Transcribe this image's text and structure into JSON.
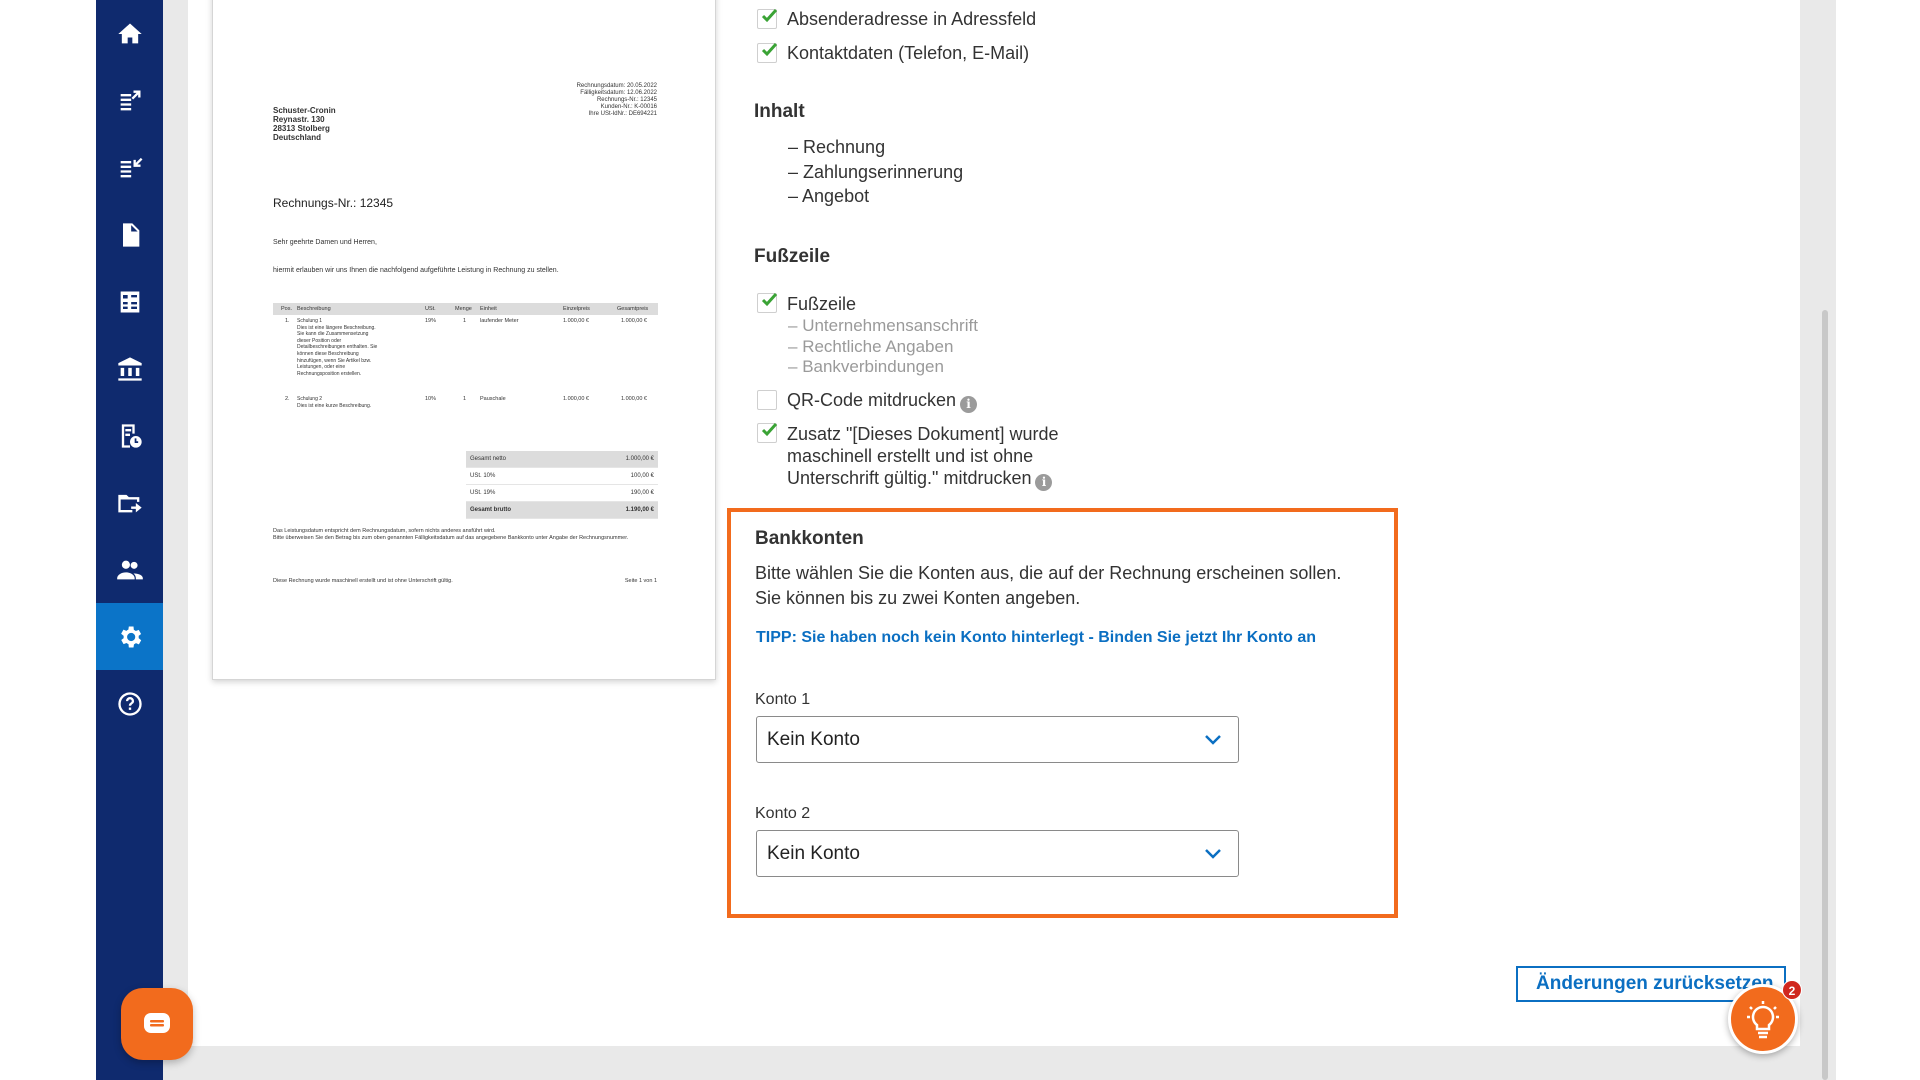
{
  "colors": {
    "sidebar": "#0f2a6e",
    "active": "#0b74c8",
    "accent_orange": "#f26b1d",
    "link_blue": "#0b6fc2",
    "check_green": "#3aa335"
  },
  "sidebar": {
    "items": [
      {
        "icon": "home-icon"
      },
      {
        "icon": "income-export-icon"
      },
      {
        "icon": "expense-import-icon"
      },
      {
        "icon": "document-icon"
      },
      {
        "icon": "calculator-icon"
      },
      {
        "icon": "bank-icon"
      },
      {
        "icon": "receipt-icon"
      },
      {
        "icon": "folder-export-icon"
      },
      {
        "icon": "people-icon"
      },
      {
        "icon": "settings-icon",
        "active": true
      },
      {
        "icon": "help-icon"
      }
    ]
  },
  "preview": {
    "sender": "Schuster-Cronin\nReynastr. 130\n28313 Stolberg\nDeutschland",
    "meta": "Rechnungsdatum: 20.05.2022\nFälligkeitsdatum: 12.06.2022\nRechnungs-Nr.: 12345\nKunden-Nr.: K-00016\nIhre USt-IdNr.: DE694221",
    "invoice_no": "Rechnungs-Nr.: 12345",
    "greeting": "Sehr geehrte Damen und Herren,",
    "intro": "hiermit erlauben wir uns Ihnen die nachfolgend aufgeführte Leistung in Rechnung zu stellen.",
    "table_headers": [
      "Pos.",
      "Beschreibung",
      "USt.",
      "Menge",
      "Einheit",
      "Einzelpreis",
      "Gesamtpreis"
    ],
    "rows": [
      {
        "pos": "1.",
        "desc": "Schulung 1\nDies ist eine längere Beschreibung.\nSie kann die Zusammensetzung\ndieser Position oder\nDetailbeschreibungen enthalten. Sie\nkönnen diese Beschreibung\nhinzufügen, wenn Sie Artikel bzw.\nLeistungen, oder eine\nRechnungsposition erstellen.",
        "vat": "19%",
        "qty": "1",
        "unit": "laufender Meter",
        "price": "1.000,00 €",
        "total": "1.000,00 €"
      },
      {
        "pos": "2.",
        "desc": "Schulung 2\nDies ist eine kurze Beschreibung.",
        "vat": "10%",
        "qty": "1",
        "unit": "Pauschale",
        "price": "1.000,00 €",
        "total": "1.000,00 €"
      }
    ],
    "totals": [
      {
        "label": "Gesamt netto",
        "value": "1.000,00 €"
      },
      {
        "label": "USt. 10%",
        "value": "100,00 €"
      },
      {
        "label": "USt. 19%",
        "value": "190,00 €"
      },
      {
        "label": "Gesamt brutto",
        "value": "1.190,00 €"
      }
    ],
    "note": "Das Leistungsdatum entspricht dem Rechnungsdatum, sofern nichts anderes ansführt wird.\nBitte überweisen Sie den Betrag bis zum oben genannten Fälligkeitsdatum auf das angegebene Bankkonto unter Angabe der Rechnungsnummer.",
    "footer_left": "Diese Rechnung wurde maschinell erstellt und ist ohne Unterschrift gültig.",
    "footer_right": "Seite 1 von 1"
  },
  "settings": {
    "address_options": [
      {
        "label": "Absenderadresse in Adressfeld",
        "checked": true
      },
      {
        "label": "Kontaktdaten (Telefon, E-Mail)",
        "checked": true
      }
    ],
    "content_heading": "Inhalt",
    "content_items": [
      "Rechnung",
      "Zahlungserinnerung",
      "Angebot"
    ],
    "footer_heading": "Fußzeile",
    "footer_checkbox": "Fußzeile",
    "footer_subitems": [
      "Unternehmensanschrift",
      "Rechtliche Angaben",
      "Bankverbindungen"
    ],
    "qr_label": "QR-Code mitdrucken",
    "addon_label_1": "Zusatz \"[Dieses Dokument] wurde",
    "addon_label_2": "maschinell erstellt und ist ohne",
    "addon_label_3": "Unterschrift gültig.\" mitdrucken"
  },
  "bank": {
    "heading": "Bankkonten",
    "desc_1": "Bitte wählen Sie die Konten aus, die auf der Rechnung erscheinen sollen.",
    "desc_2": "Sie können bis zu zwei Konten angeben.",
    "tip": "TIPP: Sie haben noch kein Konto hinterlegt - Binden Sie jetzt Ihr Konto an",
    "account1_label": "Konto 1",
    "account1_value": "Kein Konto",
    "account2_label": "Konto 2",
    "account2_value": "Kein Konto"
  },
  "actions": {
    "reset_label": "Änderungen zurücksetzen",
    "notification_count": "2"
  }
}
